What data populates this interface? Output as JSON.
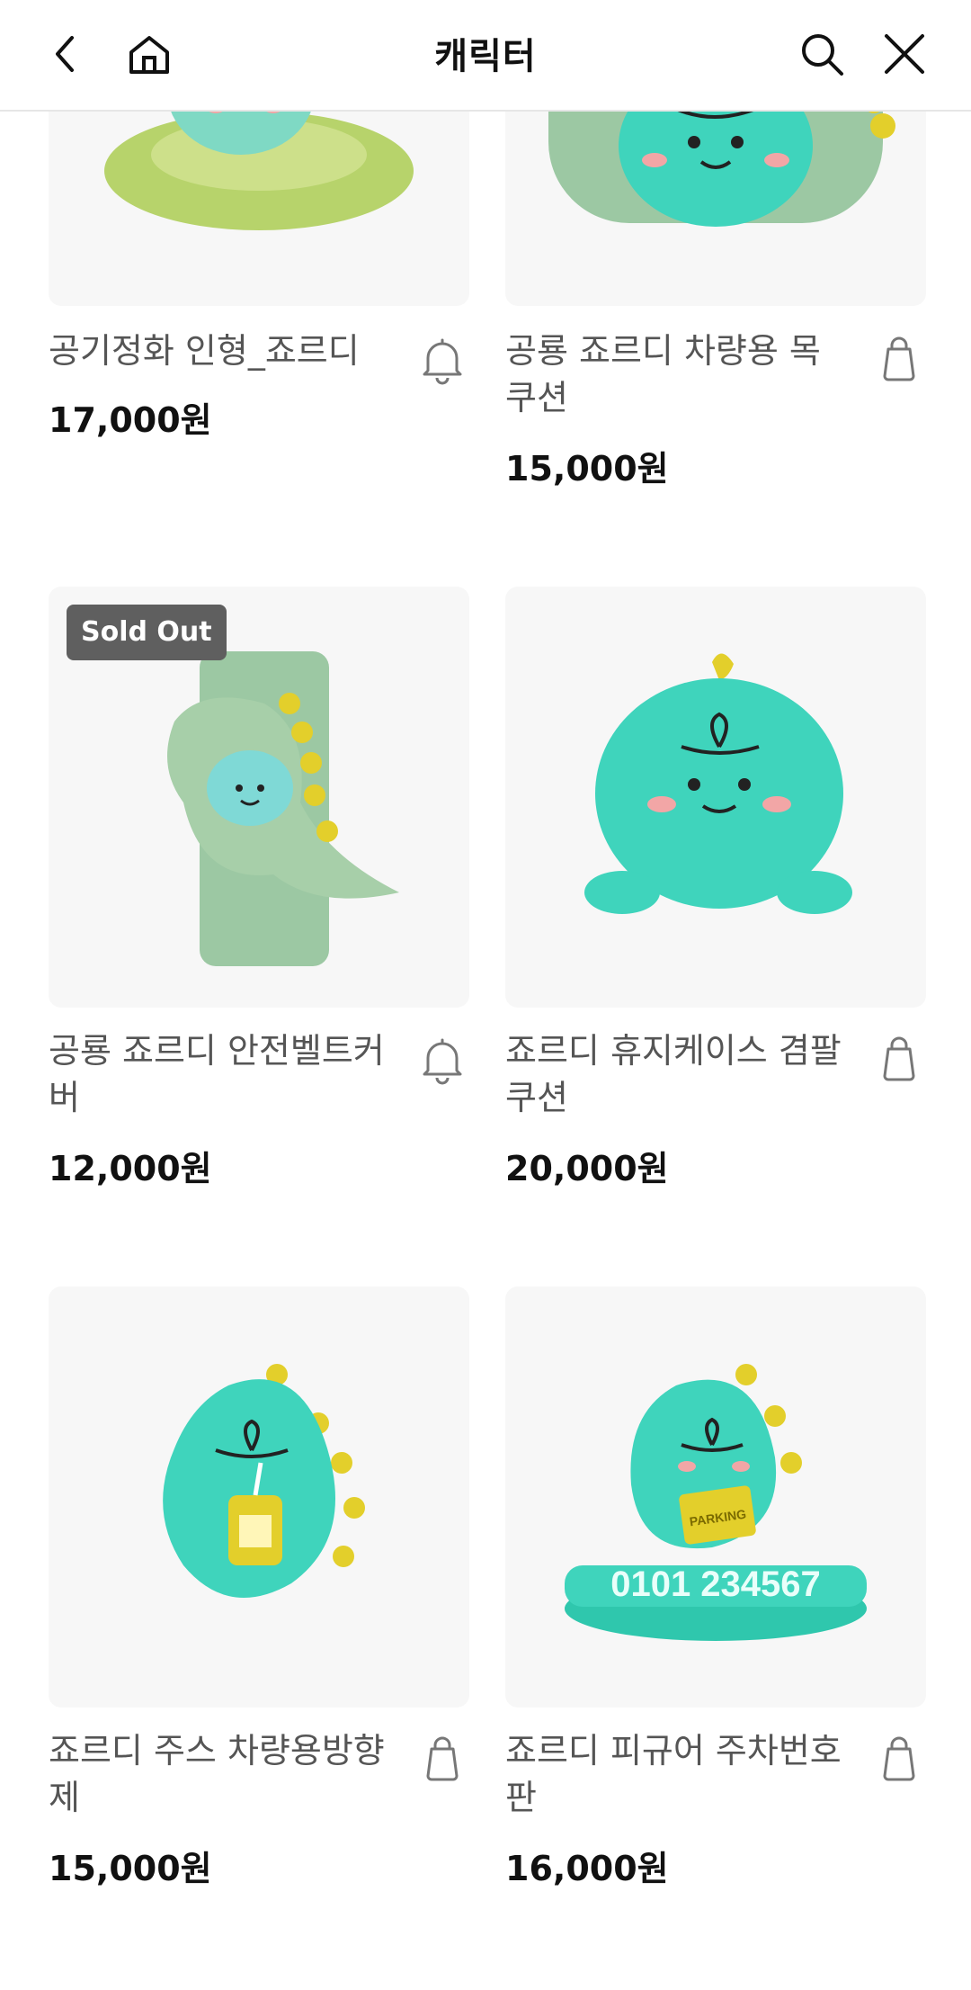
{
  "header": {
    "title": "캐릭터",
    "back_icon": "back-arrow-icon",
    "home_icon": "home-icon",
    "search_icon": "search-icon",
    "close_icon": "close-icon"
  },
  "products": [
    {
      "name": "공기정화 인형_죠르디",
      "price": "17,000원",
      "action_icon": "bell-icon"
    },
    {
      "name": "공룡 죠르디 차량용 목쿠션",
      "price": "15,000원",
      "action_icon": "shopping-bag-icon"
    },
    {
      "name": "공룡 죠르디 안전벨트커버",
      "price": "12,000원",
      "badge": "Sold Out",
      "action_icon": "bell-icon"
    },
    {
      "name": "죠르디 휴지케이스 겸팔쿠션",
      "price": "20,000원",
      "action_icon": "shopping-bag-icon"
    },
    {
      "name": "죠르디 주스 차량용방향제",
      "price": "15,000원",
      "action_icon": "shopping-bag-icon"
    },
    {
      "name": "죠르디 피규어 주차번호판",
      "price": "16,000원",
      "image_text": "PARKING",
      "plate_digits": "0101 234567",
      "action_icon": "shopping-bag-icon"
    }
  ],
  "colors": {
    "mint": "#3fd4bc",
    "sage": "#9cc8a3",
    "moss": "#b7d36b",
    "yellow": "#e3cf2b",
    "badge_bg": "#5f5f5f"
  }
}
